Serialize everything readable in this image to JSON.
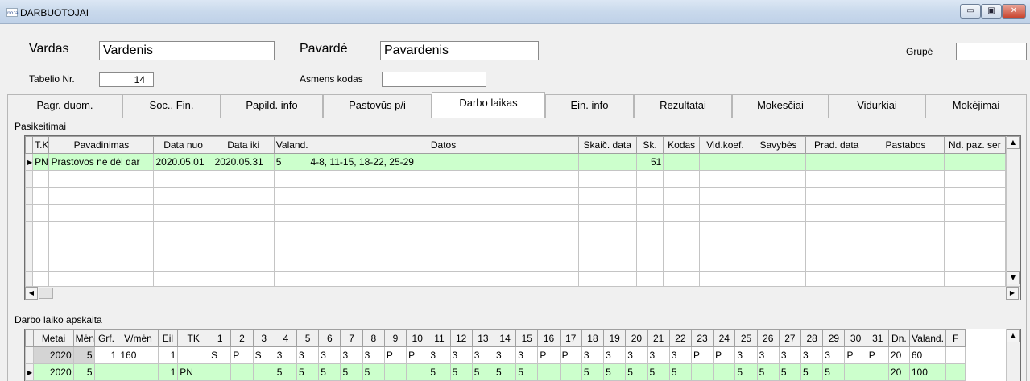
{
  "window": {
    "icon_text": "nora",
    "title": "DARBUOTOJAI",
    "minimize": "▭",
    "maximize": "▣",
    "close": "✕"
  },
  "form": {
    "vardas_label": "Vardas",
    "vardas_value": "Vardenis",
    "pavarde_label": "Pavardė",
    "pavarde_value": "Pavardenis",
    "grupe_label": "Grupė",
    "grupe_value": "",
    "tabelio_label": "Tabelio Nr.",
    "tabelio_value": "14",
    "asmens_label": "Asmens kodas",
    "asmens_value": ""
  },
  "tabs": [
    "Pagr. duom.",
    "Soc., Fin.",
    "Papild. info",
    "Pastovūs p/i",
    "Darbo laikas",
    "Ein. info",
    "Rezultatai",
    "Mokesčiai",
    "Vidurkiai",
    "Mokėjimai"
  ],
  "active_tab": "Darbo laikas",
  "changes": {
    "title": "Pasikeitimai",
    "columns": [
      "T.K.",
      "Pavadinimas",
      "Data nuo",
      "Data iki",
      "Valand.",
      "Datos",
      "Skaič. data",
      "Sk.",
      "Kodas",
      "Vid.koef.",
      "Savybės",
      "Prad. data",
      "Pastabos",
      "Nd. paz. ser"
    ],
    "rows": [
      [
        "PN",
        "Prastovos ne dėl dar",
        "2020.05.01",
        "2020.05.31",
        "5",
        "4-8, 11-15, 18-22, 25-29",
        "",
        "51",
        "",
        "",
        "",
        "",
        "",
        ""
      ]
    ],
    "empty_rows": 7
  },
  "timesheet": {
    "title": "Darbo laiko apskaita",
    "columns": [
      "Metai",
      "Mėn",
      "Grf.",
      "V/mėn",
      "Eil",
      "TK",
      "1",
      "2",
      "3",
      "4",
      "5",
      "6",
      "7",
      "8",
      "9",
      "10",
      "11",
      "12",
      "13",
      "14",
      "15",
      "16",
      "17",
      "18",
      "19",
      "20",
      "21",
      "22",
      "23",
      "24",
      "25",
      "26",
      "27",
      "28",
      "29",
      "30",
      "31",
      "Dn.",
      "Valand.",
      "F"
    ],
    "rows": [
      [
        "2020",
        "5",
        "1",
        "160",
        "1",
        "",
        "S",
        "P",
        "S",
        "3",
        "3",
        "3",
        "3",
        "3",
        "P",
        "P",
        "3",
        "3",
        "3",
        "3",
        "3",
        "P",
        "P",
        "3",
        "3",
        "3",
        "3",
        "3",
        "P",
        "P",
        "3",
        "3",
        "3",
        "3",
        "3",
        "P",
        "P",
        "20",
        "60",
        ""
      ],
      [
        "2020",
        "5",
        "",
        "",
        "1",
        "PN",
        "",
        "",
        "",
        "5",
        "5",
        "5",
        "5",
        "5",
        "",
        "",
        "5",
        "5",
        "5",
        "5",
        "5",
        "",
        "",
        "5",
        "5",
        "5",
        "5",
        "5",
        "",
        "",
        "5",
        "5",
        "5",
        "5",
        "5",
        "",
        "",
        "20",
        "100",
        ""
      ]
    ]
  },
  "colors": {
    "row_highlight": "#ccffcc",
    "title_bar": "#c9d9ec",
    "close_button": "#c9452f"
  }
}
